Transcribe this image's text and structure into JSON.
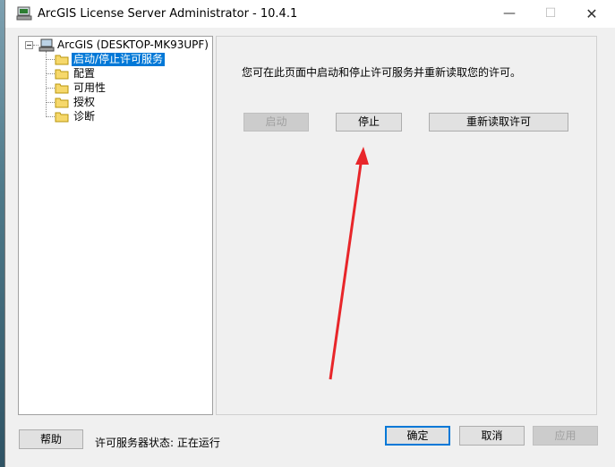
{
  "window": {
    "title": "ArcGIS License Server Administrator - 10.4.1",
    "minimize_glyph": "—",
    "maximize_glyph": "☐",
    "close_glyph": "✕"
  },
  "tree": {
    "root": "ArcGIS (DESKTOP-MK93UPF)",
    "items": [
      {
        "label": "启动/停止许可服务",
        "selected": true
      },
      {
        "label": "配置"
      },
      {
        "label": "可用性"
      },
      {
        "label": "授权"
      },
      {
        "label": "诊断"
      }
    ]
  },
  "content": {
    "description": "您可在此页面中启动和停止许可服务并重新读取您的许可。",
    "start_label": "启动",
    "stop_label": "停止",
    "reread_label": "重新读取许可"
  },
  "footer": {
    "help_label": "帮助",
    "status_text": "许可服务器状态: 正在运行",
    "ok_label": "确定",
    "cancel_label": "取消",
    "apply_label": "应用"
  },
  "colors": {
    "selection": "#0078d7",
    "annotation_arrow": "#e8262a"
  },
  "icons": {
    "app": "arcgis-license-icon",
    "root": "computer-icon",
    "item": "folder-icon"
  }
}
